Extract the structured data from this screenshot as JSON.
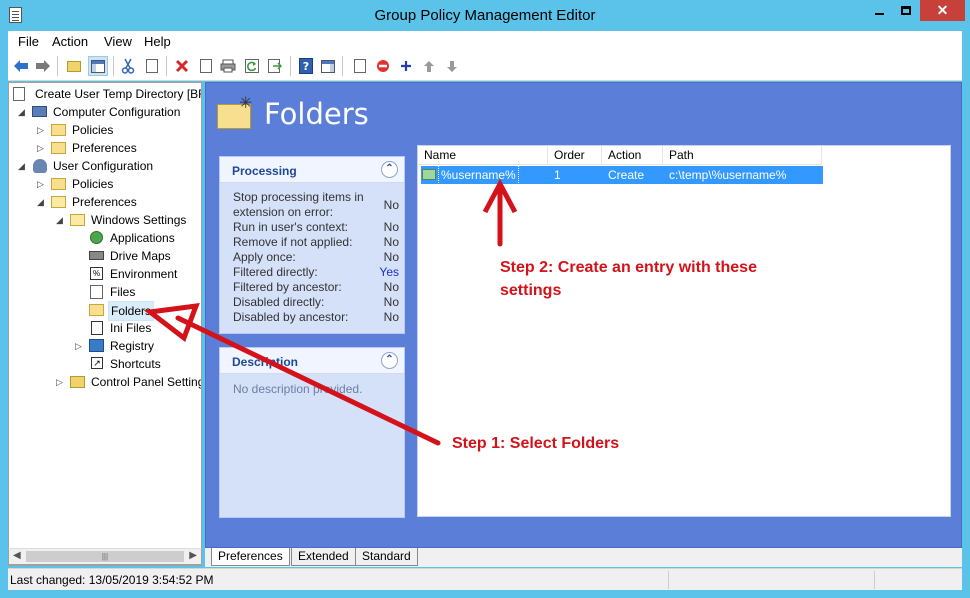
{
  "window": {
    "title": "Group Policy Management Editor",
    "minimize_icon": "minimize-icon",
    "maximize_icon": "maximize-icon",
    "close_glyph": "✕"
  },
  "menu": [
    "File",
    "Action",
    "View",
    "Help"
  ],
  "toolbar": {
    "icons": [
      "back-icon",
      "forward-icon",
      "up-folder-icon",
      "show-hide-tree-icon",
      "cut-icon",
      "copy-icon",
      "delete-icon",
      "properties-icon",
      "print-icon",
      "refresh-icon",
      "export-list-icon",
      "help-icon",
      "action-pane-icon",
      "new-item-icon",
      "disable-icon",
      "add-icon",
      "move-up-icon",
      "move-down-icon"
    ]
  },
  "tree": {
    "root": "Create User Temp Directory [BR",
    "computer_config": "Computer Configuration",
    "cc_policies": "Policies",
    "cc_preferences": "Preferences",
    "user_config": "User Configuration",
    "uc_policies": "Policies",
    "uc_preferences": "Preferences",
    "windows_settings": "Windows Settings",
    "applications": "Applications",
    "drive_maps": "Drive Maps",
    "environment": "Environment",
    "files": "Files",
    "folders": "Folders",
    "ini_files": "Ini Files",
    "registry": "Registry",
    "shortcuts": "Shortcuts",
    "control_panel": "Control Panel Setting",
    "env_glyph": "%",
    "shortcut_glyph": "↗"
  },
  "main": {
    "title": "Folders",
    "processing": {
      "title": "Processing",
      "rows": [
        {
          "label": "Stop processing items in extension on error:",
          "value": "No"
        },
        {
          "label": "Run in user's context:",
          "value": "No"
        },
        {
          "label": "Remove if not applied:",
          "value": "No"
        },
        {
          "label": "Apply once:",
          "value": "No"
        },
        {
          "label": "Filtered directly:",
          "value": "Yes"
        },
        {
          "label": "Filtered by ancestor:",
          "value": "No"
        },
        {
          "label": "Disabled directly:",
          "value": "No"
        },
        {
          "label": "Disabled by ancestor:",
          "value": "No"
        }
      ]
    },
    "description": {
      "title": "Description",
      "text": "No description provided."
    },
    "collapse_glyph": "⌃"
  },
  "list": {
    "columns": [
      "Name",
      "Order",
      "Action",
      "Path"
    ],
    "rows": [
      {
        "name": "%username%",
        "order": "1",
        "action": "Create",
        "path": "c:\\temp\\%username%"
      }
    ]
  },
  "tabs": [
    "Preferences",
    "Extended",
    "Standard"
  ],
  "status": {
    "text": "Last changed: 13/05/2019 3:54:52 PM"
  },
  "annotations": {
    "step1": "Step 1: Select Folders",
    "step2_line1": "Step 2: Create an entry with these",
    "step2_line2": "settings"
  },
  "colors": {
    "titlebar": "#5bc3ea",
    "main_bg": "#5b7ed9",
    "panel_title": "#1f4898",
    "selection": "#3399ff",
    "annotation": "#d4121a"
  }
}
